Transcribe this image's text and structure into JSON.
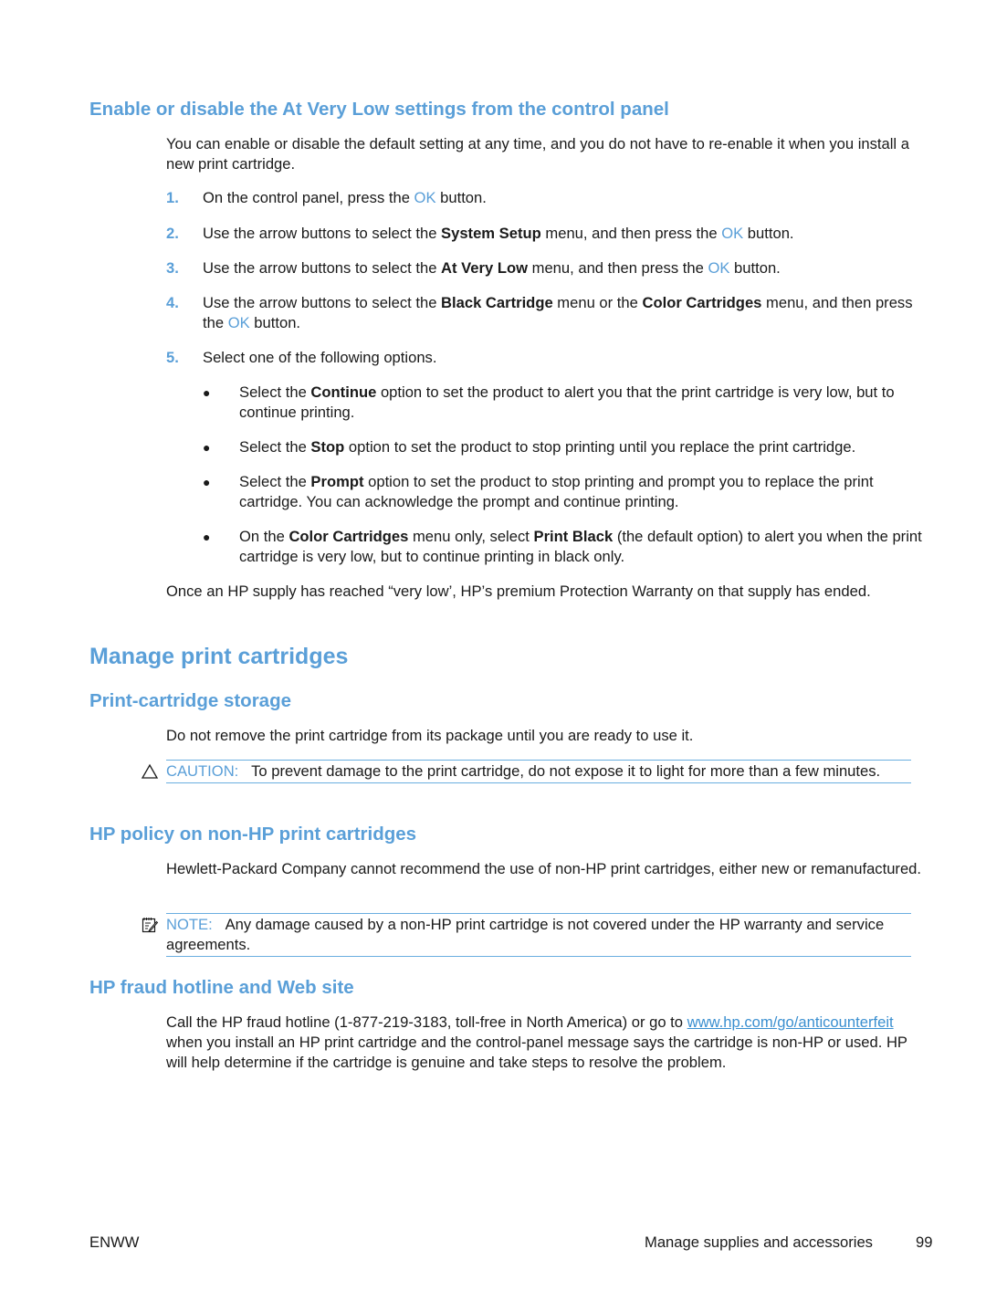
{
  "section1": {
    "heading": "Enable or disable the At Very Low settings from the control panel",
    "intro": "You can enable or disable the default setting at any time, and you do not have to re-enable it when you install a new print cartridge.",
    "steps": [
      {
        "num": "1.",
        "pre": "On the control panel, press the ",
        "ok": "OK",
        "post": " button."
      },
      {
        "num": "2.",
        "pre": "Use the arrow buttons to select the ",
        "bold": "System Setup",
        "mid": " menu, and then press the ",
        "ok": "OK",
        "post": " button."
      },
      {
        "num": "3.",
        "pre": "Use the arrow buttons to select the ",
        "bold": "At Very Low",
        "mid": " menu, and then press the ",
        "ok": "OK",
        "post": " button."
      },
      {
        "num": "4.",
        "pre": "Use the arrow buttons to select the ",
        "bold": "Black Cartridge",
        "mid": " menu or the ",
        "bold2": "Color Cartridges",
        "mid2": " menu, and then press the ",
        "ok": "OK",
        "post": " button."
      },
      {
        "num": "5.",
        "text": "Select one of the following options."
      }
    ],
    "options": [
      {
        "pre": "Select the ",
        "bold": "Continue",
        "post": " option to set the product to alert you that the print cartridge is very low, but to continue printing."
      },
      {
        "pre": "Select the ",
        "bold": "Stop",
        "post": " option to set the product to stop printing until you replace the print cartridge."
      },
      {
        "pre": "Select the ",
        "bold": "Prompt",
        "post": " option to set the product to stop printing and prompt you to replace the print cartridge. You can acknowledge the prompt and continue printing."
      },
      {
        "pre": "On the ",
        "bold": "Color Cartridges",
        "mid": " menu only, select ",
        "bold2": "Print Black",
        "post": " (the default option) to alert you when the print cartridge is very low, but to continue printing in black only."
      }
    ],
    "closing": "Once an HP supply has reached “very low’, HP’s premium Protection Warranty on that supply has ended."
  },
  "section2": {
    "heading": "Manage print cartridges",
    "storage": {
      "heading": "Print-cartridge storage",
      "body": "Do not remove the print cartridge from its package until you are ready to use it.",
      "caution_label": "CAUTION:",
      "caution_text": "To prevent damage to the print cartridge, do not expose it to light for more than a few minutes."
    },
    "policy": {
      "heading": "HP policy on non-HP print cartridges",
      "body": "Hewlett-Packard Company cannot recommend the use of non-HP print cartridges, either new or remanufactured.",
      "note_label": "NOTE:",
      "note_text": "Any damage caused by a non-HP print cartridge is not covered under the HP warranty and service agreements."
    },
    "fraud": {
      "heading": "HP fraud hotline and Web site",
      "pre": "Call the HP fraud hotline (1-877-219-3183, toll-free in North America) or go to ",
      "link": "www.hp.com/go/anticounterfeit",
      "post": " when you install an HP print cartridge and the control-panel message says the cartridge is non-HP or used. HP will help determine if the cartridge is genuine and take steps to resolve the problem."
    }
  },
  "footer": {
    "left": "ENWW",
    "section": "Manage supplies and accessories",
    "page": "99"
  }
}
